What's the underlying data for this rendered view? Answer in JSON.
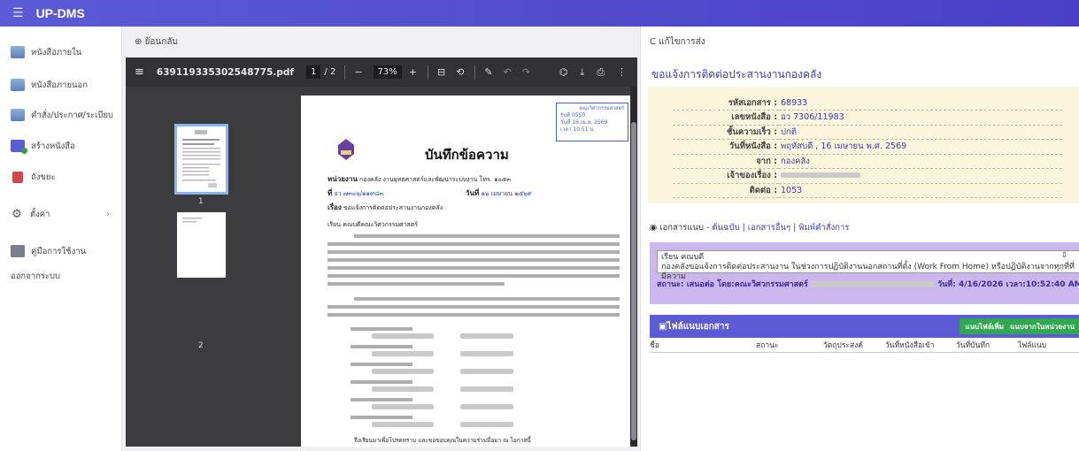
{
  "app": {
    "title": "UP-DMS"
  },
  "sidebar": {
    "items": [
      {
        "label": "หนังสือภายใน",
        "icon": "inbox-icon"
      },
      {
        "label": "หนังสือภายนอก",
        "icon": "inbox-icon"
      },
      {
        "label": "คำสั่ง/ประกาศ/ระเบียบ",
        "icon": "inbox-icon"
      },
      {
        "label": "สร้างหนังสือ",
        "icon": "create-document-icon"
      },
      {
        "label": "ถังขยะ",
        "icon": "trash-icon"
      },
      {
        "label": "ตั้งค่า",
        "icon": "gear-icon"
      },
      {
        "label": "คู่มือการใช้งาน",
        "icon": "manual-icon"
      }
    ],
    "logout": "ออกจากระบบ"
  },
  "left": {
    "back": "ย้อนกลับ",
    "pdf": {
      "filename": "639119335302548775.pdf",
      "page": "1",
      "total_pages": "/ 2",
      "zoom": "73%",
      "thumb_labels": [
        "1",
        "2"
      ]
    },
    "memo": {
      "stamp_lines": [
        "คณะวิศวกรรมศาสตร์",
        "รับที่ 0550",
        "วันที่ 16 เม.ย. 2569",
        "เวลา 10.51 น."
      ],
      "title": "บันทึกข้อความ",
      "agency_label": "หน่วยงาน",
      "agency": "กองคลัง งานยุทธศาสตร์และพัฒนาระบบงาน โทร. ๑๐๕๓",
      "no_label": "ที่",
      "no": "อว ๗๓๐๖/๑๑๙๘๓",
      "date_label": "วันที่",
      "date": "๑๖ เมษายน ๒๕๖๙",
      "subject_label": "เรื่อง",
      "subject": "ขอแจ้งการติดต่อประสานงานกองคลัง",
      "to_label": "เรียน",
      "to": "คณบดีคณะวิศวกรรมศาสตร์",
      "closing": "จึงเรียนมาเพื่อโปรดทราบ และขอขอบคุณในความร่วมมือมา ณ โอกาสนี้"
    }
  },
  "right": {
    "toolbar_label": "แก้ไขการส่ง",
    "title": "ขอแจ้งการติดต่อประสานงานกองคลัง",
    "info": [
      {
        "key": "รหัสเอกสาร :",
        "value": "68933"
      },
      {
        "key": "เลขหนังสือ :",
        "value": "อว 7306/11983"
      },
      {
        "key": "ชั้นความเร็ว :",
        "value": "ปกติ"
      },
      {
        "key": "วันที่หนังสือ :",
        "value": "พฤหัสบดี , 16 เมษายน พ.ศ. 2569"
      },
      {
        "key": "จาก :",
        "value": "กองคลัง"
      },
      {
        "key": "เจ้าของเรื่อง :",
        "value": ""
      },
      {
        "key": "ติดต่อ :",
        "value": "1053"
      }
    ],
    "docs": {
      "prefix": "เอกสารแนบ - ",
      "links": "ต้นฉบับ | เอกสารอื่นๆ | พิมพ์คำสั่งการ"
    },
    "note": {
      "line1": "เรียน คณบดี",
      "line2": "กองคลังขอแจ้งการติดต่อประสานงาน ในช่วงการปฏิบัติงานนอกสถานที่ตั้ง (Work From Home) หรือปฏิบัติงานจากทุกที่ที่มีความ",
      "status_prefix": "สถานะ: เสนอต่อ โดย:คณะวิศวกรรมศาสตร์",
      "status_suffix": "วันที่: 4/16/2026 เวลา:10:52:40 AM"
    },
    "attachments": {
      "title": "ไฟล์แนบเอกสาร",
      "btn_add": "แนบไฟล์เพิ่ม",
      "btn_from_unit": "แนบจากในหน่วยงาน",
      "columns": [
        "ชื่อ",
        "สถานะ",
        "วัตถุประสงค์",
        "วันที่หนังสือเข้า",
        "วันที่บันทึก",
        "ไฟล์แนบ"
      ]
    }
  }
}
